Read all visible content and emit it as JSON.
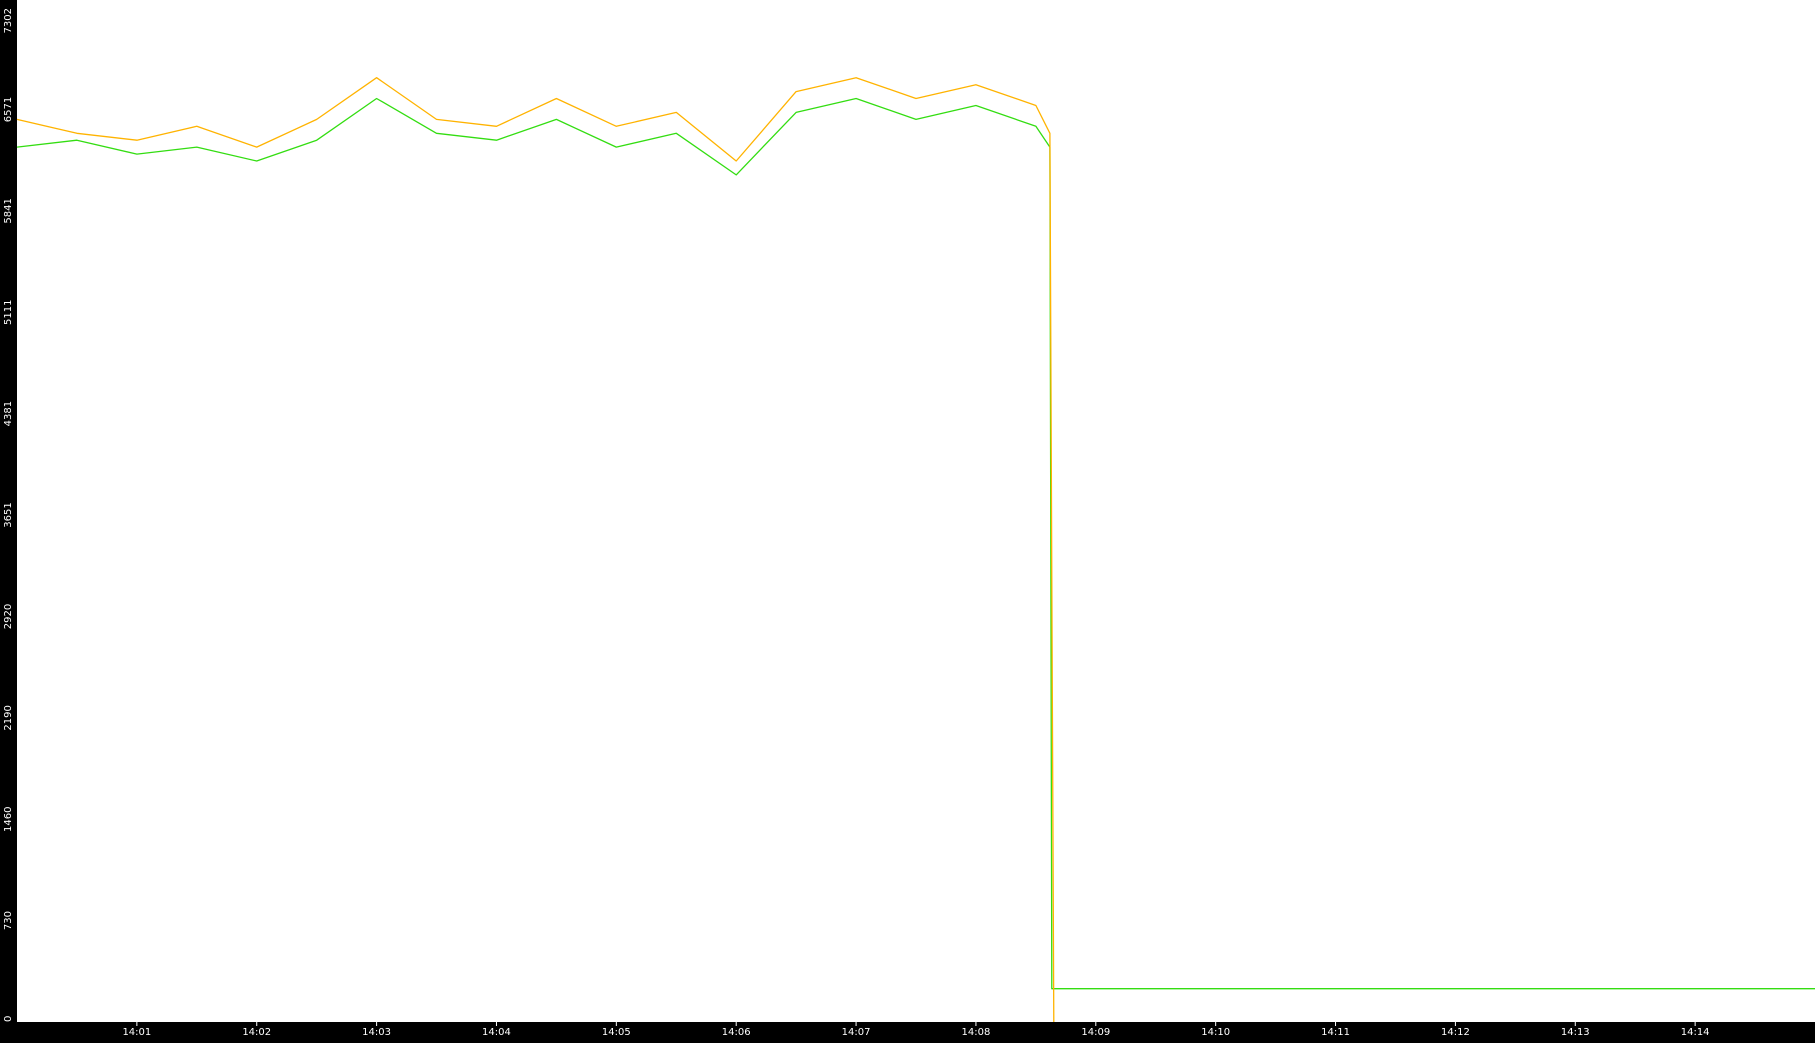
{
  "chart_data": {
    "type": "line",
    "title": "",
    "xlabel": "",
    "ylabel": "",
    "ylim": [
      0,
      7302
    ],
    "xlim": [
      "14:00",
      "14:15"
    ],
    "y_ticks": [
      "0",
      "730",
      "1460",
      "2190",
      "2920",
      "3651",
      "4381",
      "5111",
      "5841",
      "6571",
      "7302"
    ],
    "x_ticks": [
      "14:01",
      "14:02",
      "14:03",
      "14:04",
      "14:05",
      "14:06",
      "14:07",
      "14:08",
      "14:09",
      "14:10",
      "14:11",
      "14:12",
      "14:13",
      "14:14"
    ],
    "grid": false,
    "legend": "none",
    "background": "#ffffff",
    "axis_color": "#000000",
    "series": [
      {
        "color": "#33dd11",
        "x": [
          "14:00",
          "14:00:30",
          "14:01",
          "14:01:30",
          "14:02",
          "14:02:30",
          "14:03",
          "14:03:30",
          "14:04",
          "14:04:30",
          "14:05",
          "14:05:30",
          "14:06",
          "14:06:30",
          "14:07",
          "14:07:30",
          "14:08",
          "14:08:30",
          "14:08:37",
          "14:08:38",
          "14:15"
        ],
        "y": [
          6300,
          6350,
          6250,
          6300,
          6200,
          6350,
          6650,
          6400,
          6350,
          6500,
          6300,
          6400,
          6100,
          6550,
          6650,
          6500,
          6600,
          6450,
          6300,
          240,
          240
        ]
      },
      {
        "color": "#ffb300",
        "x": [
          "14:00",
          "14:00:30",
          "14:01",
          "14:01:30",
          "14:02",
          "14:02:30",
          "14:03",
          "14:03:30",
          "14:04",
          "14:04:30",
          "14:05",
          "14:05:30",
          "14:06",
          "14:06:30",
          "14:07",
          "14:07:30",
          "14:08",
          "14:08:30",
          "14:08:37",
          "14:08:38",
          "14:08:39"
        ],
        "y": [
          6500,
          6400,
          6350,
          6450,
          6300,
          6500,
          6800,
          6500,
          6450,
          6650,
          6450,
          6550,
          6200,
          6700,
          6800,
          6650,
          6750,
          6600,
          6400,
          3200,
          0
        ]
      }
    ]
  }
}
